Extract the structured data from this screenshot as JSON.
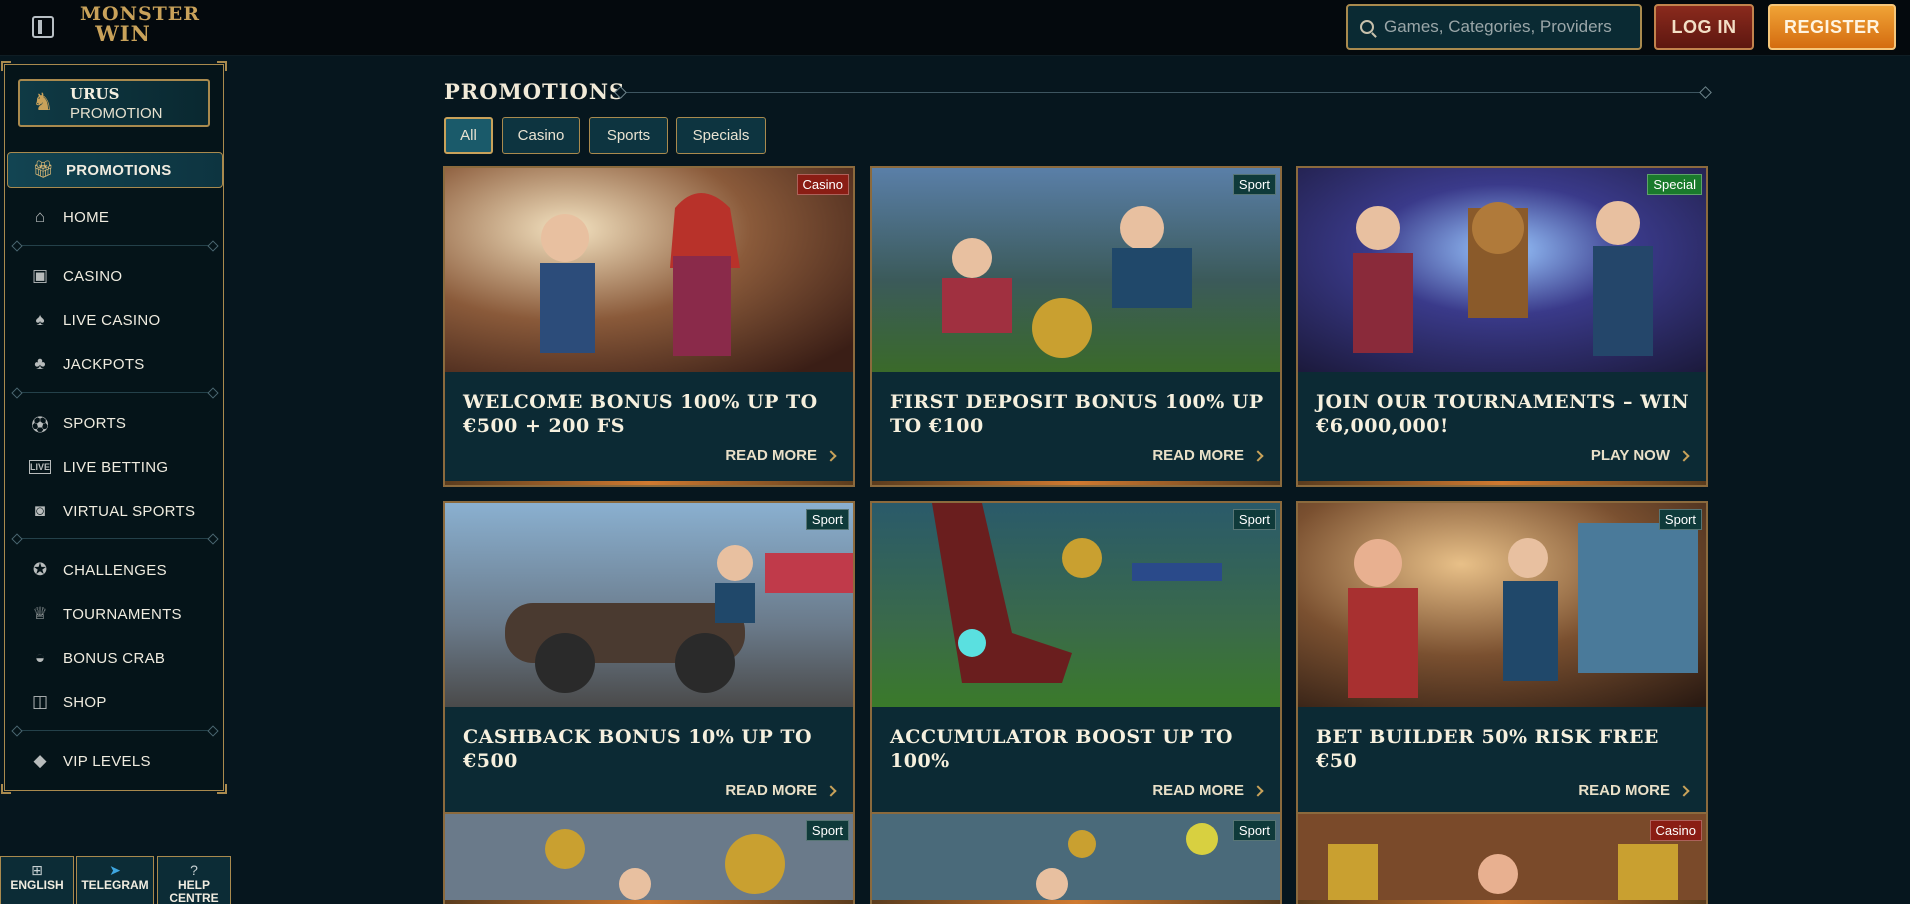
{
  "header": {
    "logo_line1": "MONSTER",
    "logo_line2": "WIN",
    "search_placeholder": "Games, Categories, Providers",
    "login_label": "LOG IN",
    "register_label": "REGISTER"
  },
  "sidebar": {
    "promo_card": {
      "line1": "URUS",
      "line2": "PROMOTION",
      "icon": "urus-bull-icon"
    },
    "items": [
      {
        "label": "PROMOTIONS",
        "icon": "gift-icon",
        "active": true
      },
      {
        "label": "HOME",
        "icon": "home-icon"
      },
      {
        "label": "CASINO",
        "icon": "slot-machine-icon"
      },
      {
        "label": "LIVE CASINO",
        "icon": "cards-icon"
      },
      {
        "label": "JACKPOTS",
        "icon": "clover-icon"
      },
      {
        "label": "SPORTS",
        "icon": "ball-icon"
      },
      {
        "label": "LIVE BETTING",
        "icon": "live-icon"
      },
      {
        "label": "VIRTUAL SPORTS",
        "icon": "virtual-icon"
      },
      {
        "label": "CHALLENGES",
        "icon": "medal-icon"
      },
      {
        "label": "TOURNAMENTS",
        "icon": "trophy-icon"
      },
      {
        "label": "BONUS CRAB",
        "icon": "crab-icon"
      },
      {
        "label": "SHOP",
        "icon": "basket-icon"
      },
      {
        "label": "VIP LEVELS",
        "icon": "diamond-icon"
      }
    ],
    "utilities": [
      {
        "label": "ENGLISH",
        "icon": "uk-flag-icon"
      },
      {
        "label": "TELEGRAM",
        "icon": "telegram-icon"
      },
      {
        "label": "HELP CENTRE",
        "icon": "help-icon"
      }
    ]
  },
  "main": {
    "title": "PROMOTIONS",
    "filters": [
      "All",
      "Casino",
      "Sports",
      "Specials"
    ],
    "active_filter": "All",
    "cards": [
      {
        "tag": "Casino",
        "tag_type": "casino",
        "title": "WELCOME BONUS 100% UP TO €500 + 200 FS",
        "cta": "READ MORE"
      },
      {
        "tag": "Sport",
        "tag_type": "sport",
        "title": "FIRST DEPOSIT BONUS 100% UP TO €100",
        "cta": "READ MORE"
      },
      {
        "tag": "Special",
        "tag_type": "special",
        "title": "JOIN OUR TOURNAMENTS – WIN €6,000,000!",
        "cta": "PLAY NOW"
      },
      {
        "tag": "Sport",
        "tag_type": "sport",
        "title": "CASHBACK BONUS 10% UP TO €500",
        "cta": "READ MORE"
      },
      {
        "tag": "Sport",
        "tag_type": "sport",
        "title": "ACCUMULATOR BOOST UP TO 100%",
        "cta": "READ MORE"
      },
      {
        "tag": "Sport",
        "tag_type": "sport",
        "title": "BET BUILDER 50% RISK FREE €50",
        "cta": "READ MORE"
      },
      {
        "tag": "Sport",
        "tag_type": "sport"
      },
      {
        "tag": "Sport",
        "tag_type": "sport"
      },
      {
        "tag": "Casino",
        "tag_type": "casino"
      }
    ]
  },
  "colors": {
    "background": "#06161e",
    "gold_border": "#a98a4e",
    "register": "#e88a22",
    "login": "#7a2418"
  }
}
